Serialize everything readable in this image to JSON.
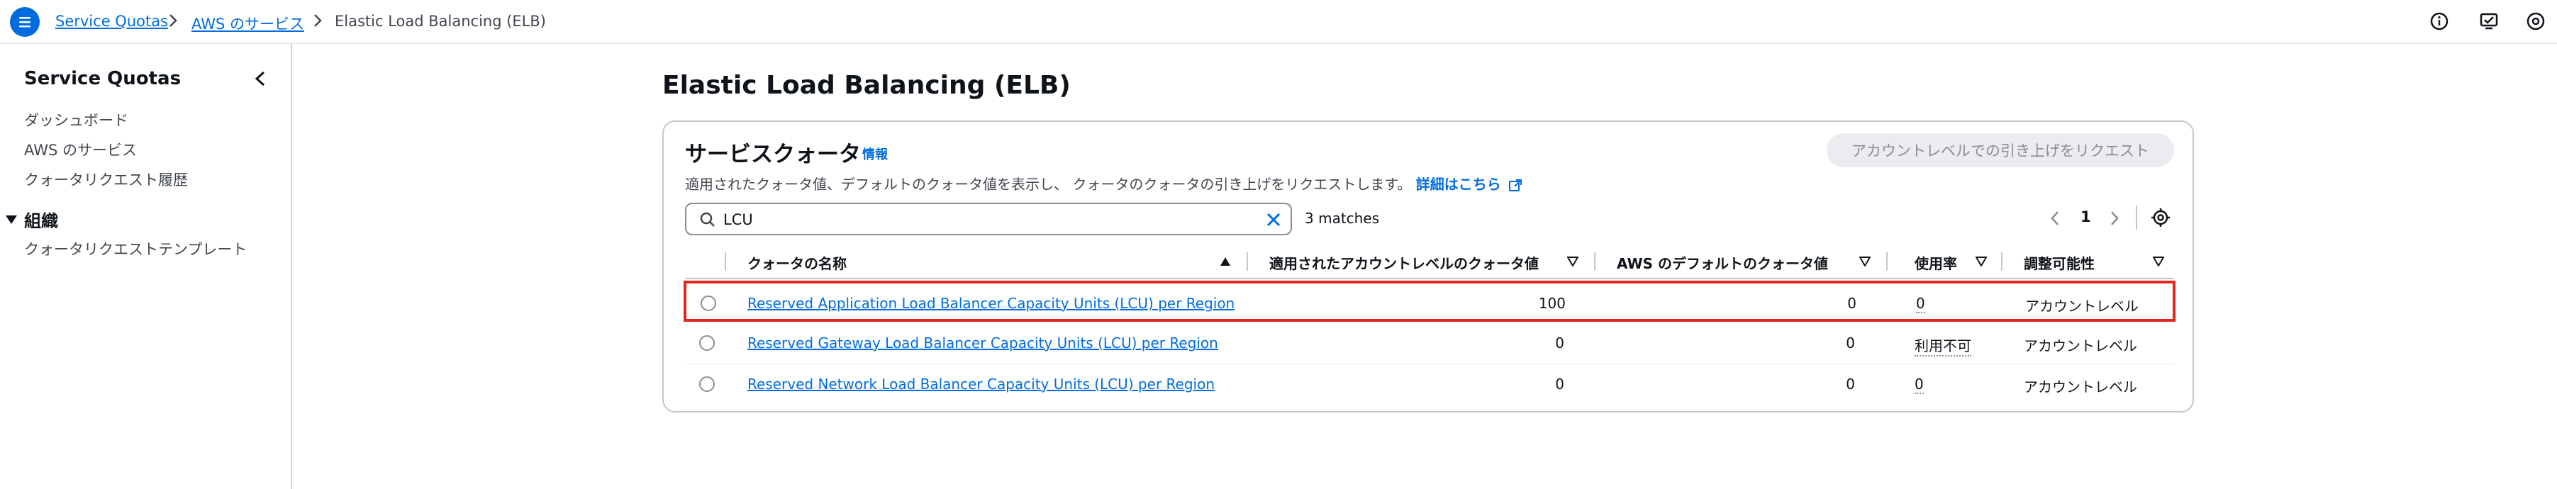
{
  "breadcrumb": {
    "items": [
      "Service Quotas",
      "AWS のサービス"
    ],
    "current": "Elastic Load Balancing (ELB)"
  },
  "sidebar": {
    "title": "Service Quotas",
    "items": [
      "ダッシュボード",
      "AWS のサービス",
      "クォータリクエスト履歴"
    ],
    "section": {
      "label": "組織",
      "items": [
        "クォータリクエストテンプレート"
      ]
    }
  },
  "page": {
    "title": "Elastic Load Balancing (ELB)"
  },
  "panel": {
    "title": "サービスクォータ",
    "info_label": "情報",
    "description": "適用されたクォータ値、デフォルトのクォータ値を表示し、 クォータのクォータの引き上げをリクエストします。",
    "detail_link": "詳細はこちら",
    "request_button": "アカウントレベルでの引き上げをリクエスト"
  },
  "search": {
    "value": "LCU",
    "matches": "3 matches"
  },
  "pagination": {
    "current_page": "1"
  },
  "table": {
    "columns": [
      "クォータの名称",
      "適用されたアカウントレベルのクォータ値",
      "AWS のデフォルトのクォータ値",
      "使用率",
      "調整可能性"
    ],
    "rows": [
      {
        "name": "Reserved Application Load Balancer Capacity Units (LCU) per Region",
        "applied": "100",
        "default": "0",
        "usage": "0",
        "adjustable": "アカウントレベル",
        "selected": true
      },
      {
        "name": "Reserved Gateway Load Balancer Capacity Units (LCU) per Region",
        "applied": "0",
        "default": "0",
        "usage": "利用不可",
        "adjustable": "アカウントレベル",
        "selected": false
      },
      {
        "name": "Reserved Network Load Balancer Capacity Units (LCU) per Region",
        "applied": "0",
        "default": "0",
        "usage": "0",
        "adjustable": "アカウントレベル",
        "selected": false
      }
    ]
  },
  "colors": {
    "accent": "#006ce0",
    "highlight": "#e1261c",
    "text": "#0f141a",
    "muted": "#424650"
  }
}
